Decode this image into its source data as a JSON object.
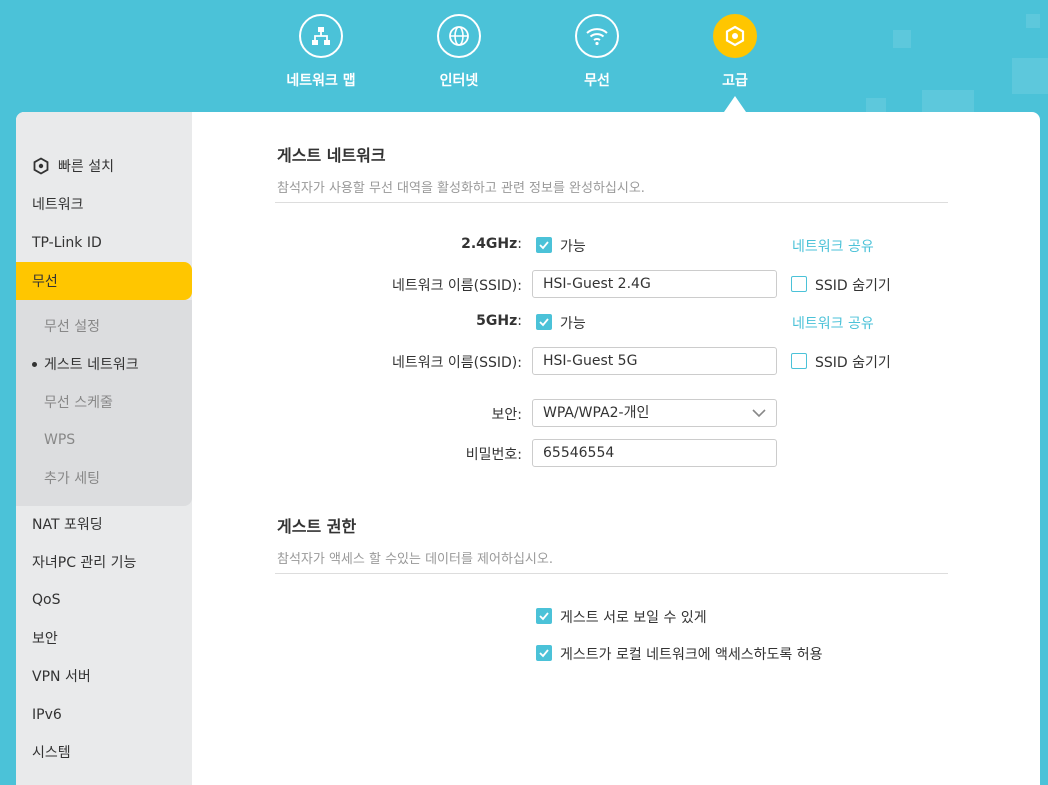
{
  "nav": {
    "items": [
      {
        "label": "네트워크 맵",
        "icon": "network-map-icon"
      },
      {
        "label": "인터넷",
        "icon": "globe-icon"
      },
      {
        "label": "무선",
        "icon": "wifi-icon"
      },
      {
        "label": "고급",
        "icon": "gear-icon"
      }
    ],
    "active_index": 3
  },
  "sidebar": {
    "quick_setup": "빠른 설치",
    "items_top": [
      "네트워크",
      "TP-Link ID"
    ],
    "active": "무선",
    "sub_items": [
      "무선 설정",
      "게스트 네트워크",
      "무선 스케줄",
      "WPS",
      "추가 세팅"
    ],
    "current_sub": "게스트 네트워크",
    "items_bottom": [
      "NAT 포워딩",
      "자녀PC 관리 기능",
      "QoS",
      "보안",
      "VPN 서버",
      "IPv6",
      "시스템"
    ]
  },
  "guest_network": {
    "title": "게스트 네트워크",
    "desc": "참석자가 사용할 무선 대역을 활성화하고 관련 정보를 완성하십시오.",
    "band24": {
      "label": "2.4GHz",
      "enable_label": "가능",
      "enabled": true,
      "share_link": "네트워크 공유"
    },
    "ssid24": {
      "label": "네트워크 이름(SSID):",
      "value": "HSI-Guest 2.4G",
      "hide_label": "SSID 숨기기",
      "hidden": false
    },
    "band5": {
      "label": "5GHz",
      "enable_label": "가능",
      "enabled": true,
      "share_link": "네트워크 공유"
    },
    "ssid5": {
      "label": "네트워크 이름(SSID):",
      "value": "HSI-Guest 5G",
      "hide_label": "SSID 숨기기",
      "hidden": false
    },
    "security": {
      "label": "보안:",
      "value": "WPA/WPA2-개인"
    },
    "password": {
      "label": "비밀번호:",
      "value": "65546554"
    }
  },
  "guest_permissions": {
    "title": "게스트 권한",
    "desc": "참석자가 액세스 할 수있는 데이터를 제어하십시오.",
    "see_each_other": "게스트 서로 보일 수 있게",
    "local_access": "게스트가 로컬 네트워크에 액세스하도록 허용"
  },
  "colors": {
    "accent": "#4bc2d8",
    "active": "#ffc600",
    "sidebar": "#e9eaeb"
  }
}
